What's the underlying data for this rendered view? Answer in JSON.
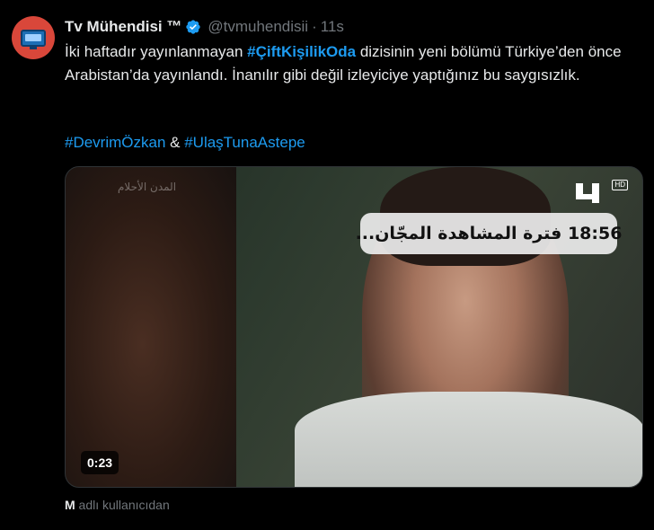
{
  "tweet": {
    "author": {
      "display_name": "Tv Mühendisi ™",
      "handle": "@tvmuhendisii",
      "separator": "·",
      "time": "11s",
      "verified": true,
      "avatar_icon": "tv-icon"
    },
    "text": {
      "part1": "İki haftadır yayınlanmayan ",
      "hashtag_main": "#ÇiftKişilikOda",
      "part2": " dizisinin yeni bölümü Türkiye’den önce Arabistan’da yayınlandı. İnanılır gibi değil izleyiciye yaptığınız bu saygısızlık."
    },
    "tags": {
      "tag1": "#DevrimÖzkan",
      "joiner": " & ",
      "tag2": "#UlaşTunaAstepe"
    },
    "media": {
      "overlay_text": "18:56 فترة المشاهدة المجّان...",
      "watermark_text": "المدن الأحلام",
      "hd_label": "HD",
      "duration": "0:23"
    },
    "attribution": {
      "initial": "M",
      "text": " adlı kullanıcıdan"
    }
  },
  "colors": {
    "background": "#000000",
    "text": "#e7e9ea",
    "muted": "#71767b",
    "link": "#1d9bf0",
    "verified": "#1d9bf0"
  }
}
